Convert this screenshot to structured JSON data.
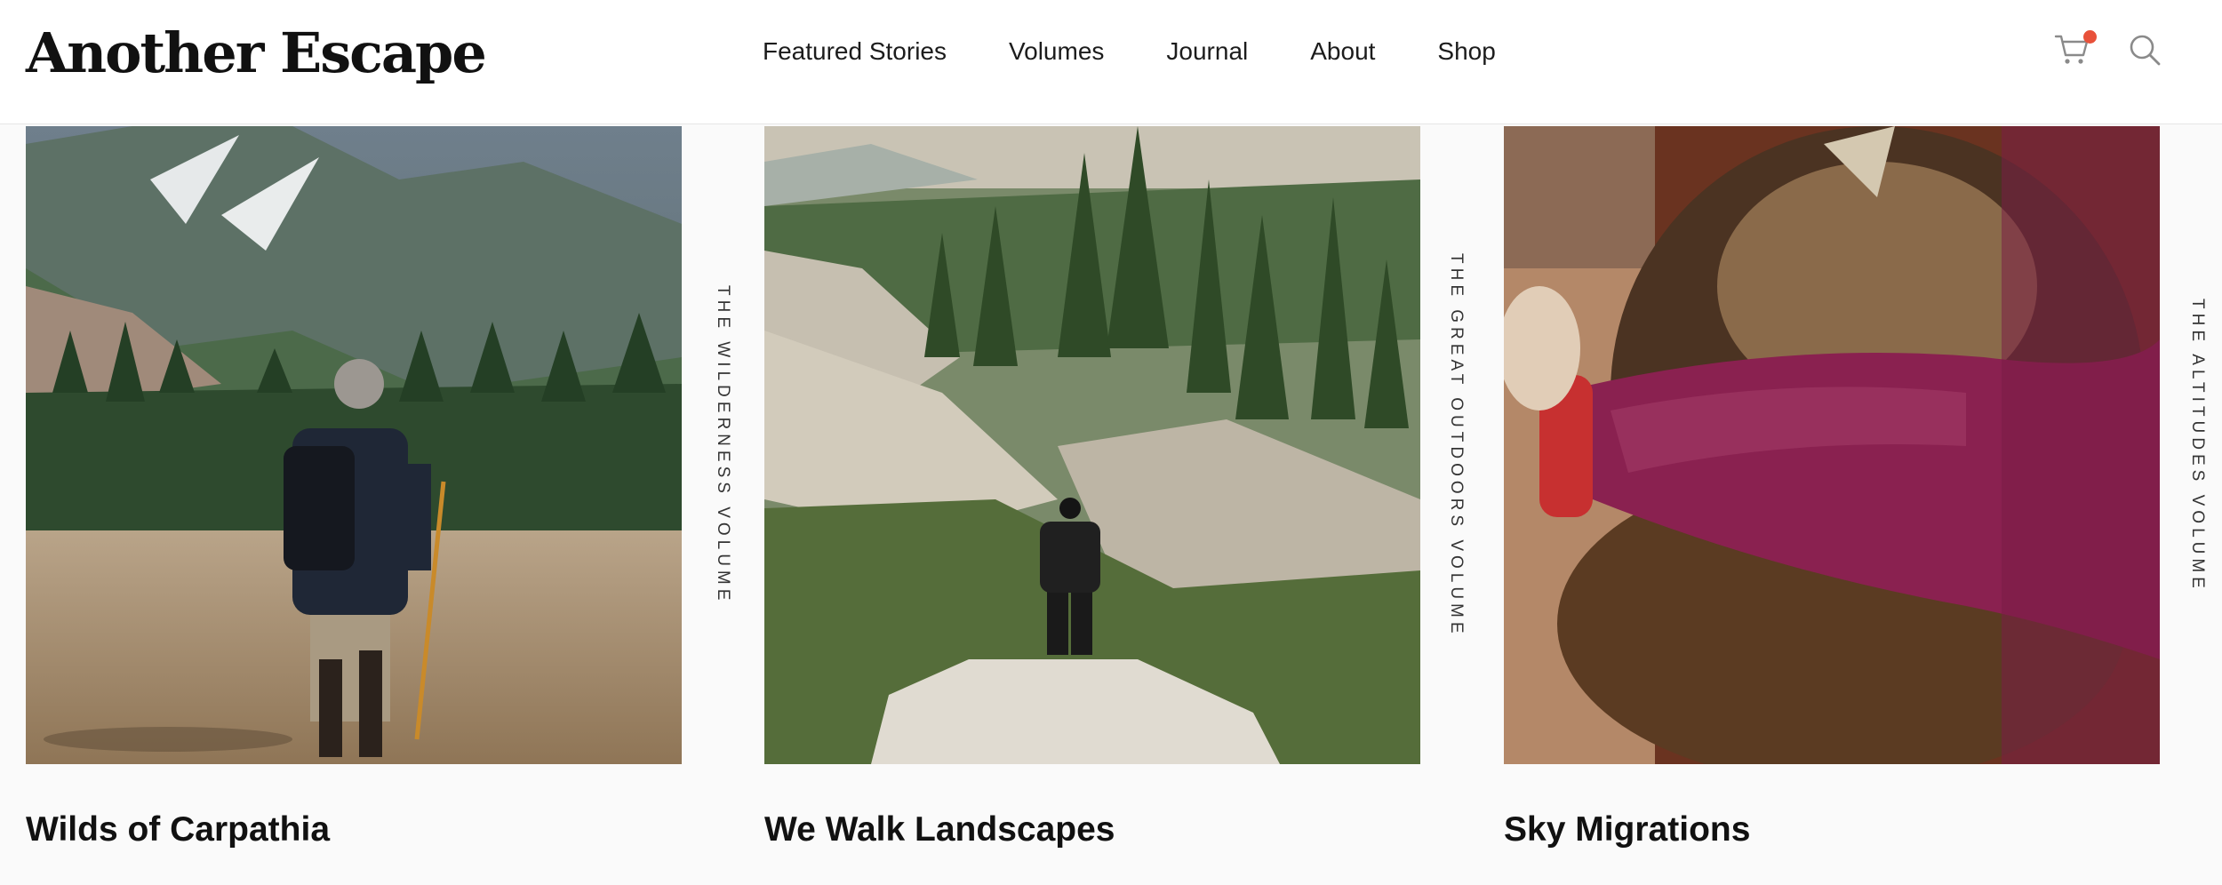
{
  "header": {
    "logo": "Another Escape",
    "nav": [
      "Featured Stories",
      "Volumes",
      "Journal",
      "About",
      "Shop"
    ],
    "icons": {
      "cart": "cart-icon",
      "search": "search-icon"
    },
    "colors": {
      "cart_badge": "#e8513a"
    }
  },
  "cards": [
    {
      "title": "Wilds of Carpathia",
      "volume_label": "THE WILDERNESS VOLUME",
      "image": "hiker-mountain-meadow-image"
    },
    {
      "title": "We Walk Landscapes",
      "volume_label": "THE GREAT OUTDOORS VOLUME",
      "image": "hiker-granite-forest-image"
    },
    {
      "title": "Sky Migrations",
      "volume_label": "THE ALTITUDES VOLUME",
      "image": "eagle-held-in-arms-image"
    }
  ]
}
